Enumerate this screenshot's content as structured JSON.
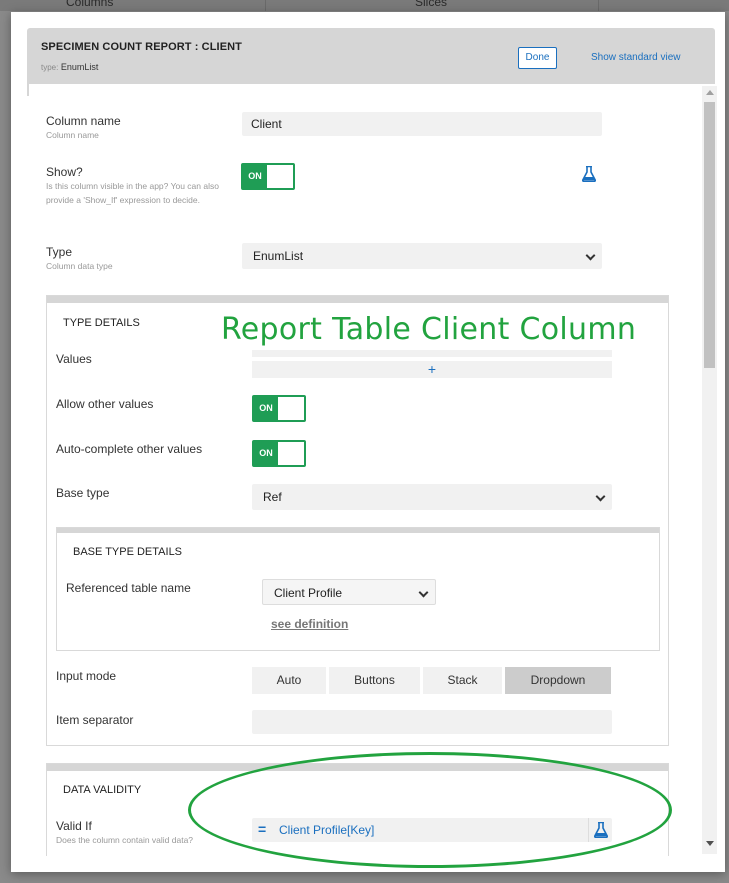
{
  "background": {
    "tabs": [
      "Columns",
      "Slices"
    ]
  },
  "modal": {
    "title": "SPECIMEN COUNT REPORT : CLIENT",
    "type_label": "type:",
    "type_value": "EnumList",
    "done_label": "Done",
    "standard_view_label": "Show standard view"
  },
  "fields": {
    "column_name": {
      "label": "Column name",
      "sublabel": "Column name",
      "value": "Client"
    },
    "show": {
      "label": "Show?",
      "sublabel": "Is this column visible in the app? You can also provide a 'Show_If' expression to decide.",
      "toggle": "ON"
    },
    "type": {
      "label": "Type",
      "sublabel": "Column data type",
      "value": "EnumList"
    }
  },
  "type_details": {
    "title": "TYPE DETAILS",
    "values_label": "Values",
    "add_symbol": "+",
    "allow_other_label": "Allow other values",
    "allow_other_toggle": "ON",
    "autocomplete_label": "Auto-complete other values",
    "autocomplete_toggle": "ON",
    "base_type_label": "Base type",
    "base_type_value": "Ref",
    "base_type_details": {
      "title": "BASE TYPE DETAILS",
      "ref_table_label": "Referenced table name",
      "ref_table_value": "Client Profile",
      "see_definition": "see definition"
    },
    "input_mode_label": "Input mode",
    "input_modes": [
      "Auto",
      "Buttons",
      "Stack",
      "Dropdown"
    ],
    "input_mode_selected": "Dropdown",
    "item_separator_label": "Item separator"
  },
  "data_validity": {
    "title": "DATA VALIDITY",
    "valid_if_label": "Valid If",
    "valid_if_sublabel": "Does the column contain valid data?",
    "eq_symbol": "=",
    "valid_if_expression": "Client Profile[Key]"
  },
  "annotation": {
    "text": "Report Table Client Column",
    "color": "#22a33f"
  },
  "colors": {
    "accent_blue": "#1a6fbf",
    "toggle_green": "#1f9d55"
  }
}
